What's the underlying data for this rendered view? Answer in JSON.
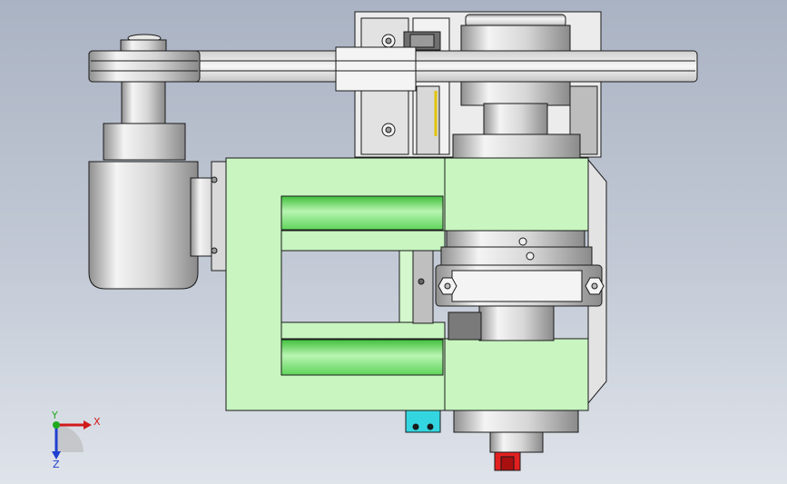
{
  "view": {
    "background_top": "#aab3c3",
    "background_bottom": "#dfe3ea"
  },
  "colors": {
    "frame_green": "#c8f5c0",
    "roller_green": "#7fe07a",
    "metal_light": "#f2f2f2",
    "metal_mid": "#c9c9c9",
    "metal_dark": "#8d8d8d",
    "outline": "#1a1a1a",
    "connector_cyan": "#33d6e0",
    "handle_red": "#e32020",
    "belt": "#e9e9e9"
  },
  "triad": {
    "x_label": "X",
    "y_label": "Y",
    "z_label": "Z",
    "x_color": "#d11a1a",
    "y_color": "#1faa1f",
    "z_color": "#1f3fd1"
  }
}
